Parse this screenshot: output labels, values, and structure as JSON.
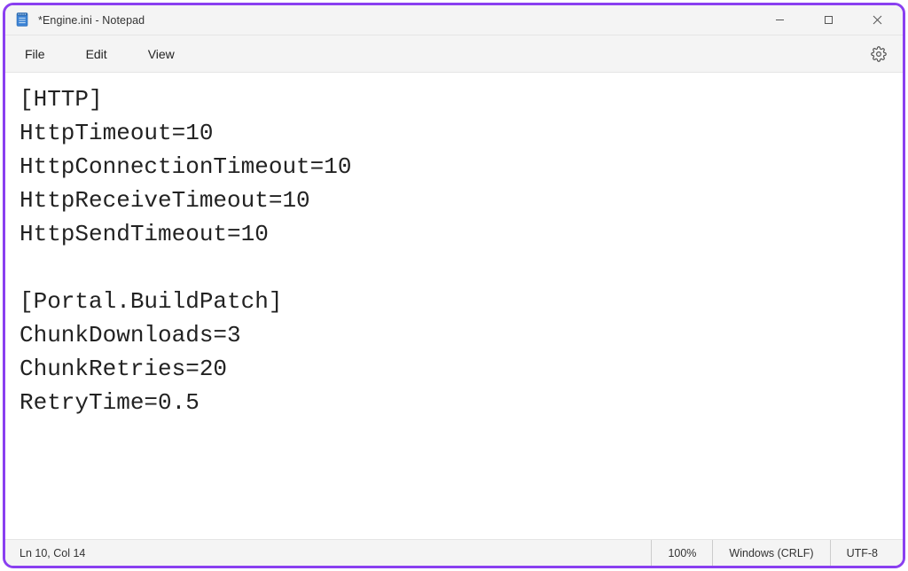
{
  "window": {
    "title": "*Engine.ini - Notepad"
  },
  "menu": {
    "file": "File",
    "edit": "Edit",
    "view": "View"
  },
  "document": {
    "text": "[HTTP]\nHttpTimeout=10\nHttpConnectionTimeout=10\nHttpReceiveTimeout=10\nHttpSendTimeout=10\n\n[Portal.BuildPatch]\nChunkDownloads=3\nChunkRetries=20\nRetryTime=0.5"
  },
  "status": {
    "cursor": "Ln 10, Col 14",
    "zoom": "100%",
    "line_endings": "Windows (CRLF)",
    "encoding": "UTF-8"
  }
}
